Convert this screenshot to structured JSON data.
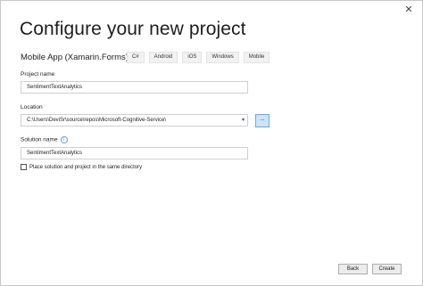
{
  "dialog": {
    "close_glyph": "✕",
    "title": "Configure your new project"
  },
  "template": {
    "name": "Mobile App (Xamarin.Forms)",
    "tags": [
      "C#",
      "Android",
      "iOS",
      "Windows",
      "Mobile"
    ]
  },
  "project_name": {
    "label": "Project name",
    "value": "SentimentTextAnalytics"
  },
  "location": {
    "label": "Location",
    "value": "C:\\Users\\DeviSr\\source\\repos\\Microsoft-Cognitive-Service\\",
    "browse_label": "..."
  },
  "solution_name": {
    "label": "Solution name",
    "info_glyph": "i",
    "value": "SentimentTextAnalytics"
  },
  "place_in_same_directory": {
    "label": "Place solution and project in the same directory",
    "checked": false
  },
  "footer": {
    "back_label": "Back",
    "create_label": "Create"
  },
  "colors": {
    "browse_button_bg": "#cce4f7",
    "browse_button_border": "#6aa9dc"
  }
}
